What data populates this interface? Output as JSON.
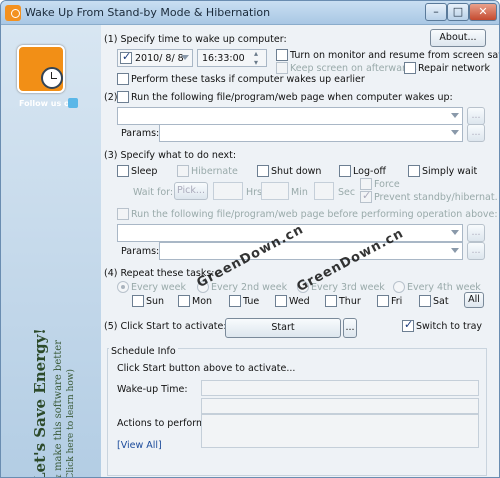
{
  "window": {
    "title": "Wake Up From Stand-by Mode & Hibernation",
    "min_symbol": "–",
    "max_symbol": "□",
    "close_symbol": "✕"
  },
  "sidebar": {
    "follow_text": "Follow us on",
    "energy_title": "Let's Save Energy!",
    "energy_sub1": "& make this software better",
    "energy_sub2": "(Click here to learn how)"
  },
  "about_label": "About...",
  "section1": {
    "label": "(1) Specify time to wake up computer:",
    "date": "2010/ 8/ 8",
    "time": "16:33:00",
    "turn_on_monitor": "Turn on monitor and resume from screen saver",
    "keep_screen_on": "Keep screen on afterwards",
    "repair_network": "Repair network",
    "perform_earlier": "Perform these tasks if computer wakes up earlier"
  },
  "section2": {
    "label": "(2)",
    "run_label": "Run the following file/program/web page when computer wakes up:",
    "params_label": "Params:",
    "browse": "..."
  },
  "section3": {
    "label": "(3) Specify what to do next:",
    "sleep": "Sleep",
    "hibernate": "Hibernate",
    "shutdown": "Shut down",
    "logoff": "Log-off",
    "simply_wait": "Simply wait",
    "wait_for": "Wait for:",
    "pick": "Pick...",
    "hrs": "Hrs",
    "min": "Min",
    "sec": "Sec",
    "force": "Force",
    "prevent": "Prevent standby/hibernat.",
    "run_before": "Run the following file/program/web page before performing operation above:",
    "params_label": "Params:",
    "browse": "..."
  },
  "section4": {
    "label": "(4) Repeat these tasks:",
    "every_week": "Every week",
    "every_2nd": "Every 2nd week",
    "every_3rd": "Every 3rd week",
    "every_4th": "Every 4th week",
    "days": [
      "Sun",
      "Mon",
      "Tue",
      "Wed",
      "Thur",
      "Fri",
      "Sat"
    ],
    "all": "All"
  },
  "section5": {
    "label": "(5) Click Start to activate:",
    "start": "Start",
    "browse": "...",
    "switch_tray": "Switch to tray"
  },
  "schedule": {
    "title": "Schedule Info",
    "hint": "Click Start button above to activate...",
    "wakeup_label": "Wake-up Time:",
    "actions_label": "Actions to perform:",
    "view_all": "[View All]"
  },
  "watermark": "GreenDown.cn"
}
